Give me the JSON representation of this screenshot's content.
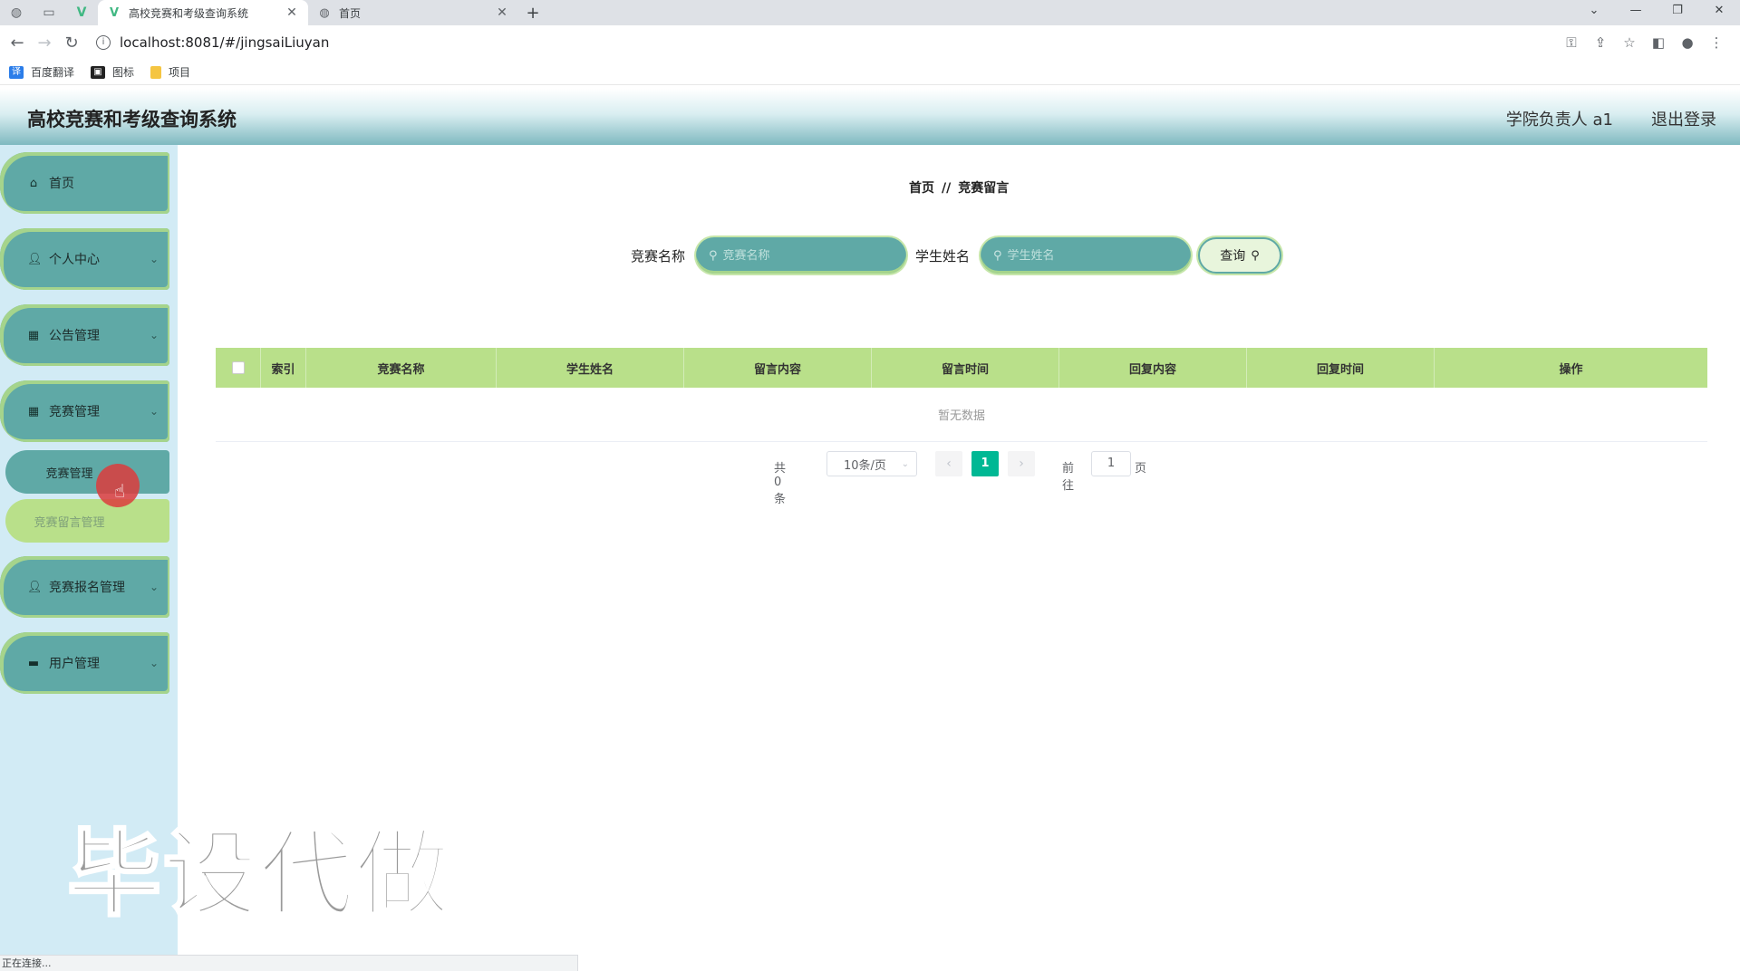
{
  "browser": {
    "tabs": [
      {
        "title": "高校竞赛和考级查询系统",
        "active": true
      },
      {
        "title": "首页",
        "active": false
      }
    ],
    "url": "localhost:8081/#/jingsaiLiuyan",
    "bookmarks": [
      "百度翻译",
      "图标",
      "项目"
    ],
    "status": "正在连接..."
  },
  "header": {
    "title": "高校竞赛和考级查询系统",
    "user": "学院负责人 a1",
    "logout": "退出登录"
  },
  "sidebar": {
    "items": [
      {
        "label": "首页",
        "icon": "home-icon"
      },
      {
        "label": "个人中心",
        "icon": "user-icon"
      },
      {
        "label": "公告管理",
        "icon": "grid-icon"
      },
      {
        "label": "竞赛管理",
        "icon": "grid-icon"
      },
      {
        "label": "竞赛报名管理",
        "icon": "user-icon"
      },
      {
        "label": "用户管理",
        "icon": "chat-icon"
      }
    ],
    "submenu": [
      {
        "label": "竞赛管理"
      },
      {
        "label": "竞赛留言管理"
      }
    ]
  },
  "breadcrumb": {
    "home": "首页",
    "sep": "//",
    "current": "竞赛留言"
  },
  "search": {
    "field1_label": "竞赛名称",
    "field1_placeholder": "竞赛名称",
    "field2_label": "学生姓名",
    "field2_placeholder": "学生姓名",
    "button": "查询"
  },
  "table": {
    "columns": [
      "索引",
      "竞赛名称",
      "学生姓名",
      "留言内容",
      "留言时间",
      "回复内容",
      "回复时间",
      "操作"
    ],
    "empty": "暂无数据"
  },
  "pagination": {
    "total": "共 0 条",
    "page_size": "10条/页",
    "current": "1",
    "jump_label": "前往",
    "jump_value": "1",
    "unit": "页"
  },
  "watermark": "毕设代做"
}
